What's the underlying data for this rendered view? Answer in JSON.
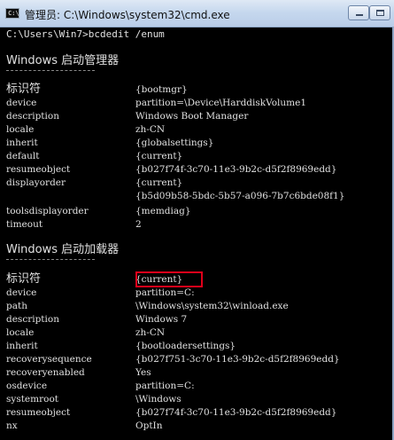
{
  "window": {
    "title": "管理员: C:\\Windows\\system32\\cmd.exe",
    "icon_label": "C:\\"
  },
  "console": {
    "prompt_line": "C:\\Users\\Win7>bcdedit /enum",
    "sections": [
      {
        "heading": "Windows 启动管理器",
        "rows": [
          {
            "key": "标识符",
            "value": "{bootmgr}"
          },
          {
            "key": "device",
            "value": "partition=\\Device\\HarddiskVolume1"
          },
          {
            "key": "description",
            "value": "Windows Boot Manager"
          },
          {
            "key": "locale",
            "value": "zh-CN"
          },
          {
            "key": "inherit",
            "value": "{globalsettings}"
          },
          {
            "key": "default",
            "value": "{current}"
          },
          {
            "key": "resumeobject",
            "value": "{b027f74f-3c70-11e3-9b2c-d5f2f8969edd}"
          },
          {
            "key": "displayorder",
            "value": "{current}"
          },
          {
            "key": "",
            "value": "{b5d09b58-5bdc-5b57-a096-7b7c6bde08f1}"
          },
          {
            "key": "toolsdisplayorder",
            "value": "{memdiag}"
          },
          {
            "key": "timeout",
            "value": "2"
          }
        ]
      },
      {
        "heading": "Windows 启动加载器",
        "rows": [
          {
            "key": "标识符",
            "value": "{current}"
          },
          {
            "key": "device",
            "value": "partition=C:"
          },
          {
            "key": "path",
            "value": "\\Windows\\system32\\winload.exe"
          },
          {
            "key": "description",
            "value": "Windows 7"
          },
          {
            "key": "locale",
            "value": "zh-CN"
          },
          {
            "key": "inherit",
            "value": "{bootloadersettings}"
          },
          {
            "key": "recoverysequence",
            "value": "{b027f751-3c70-11e3-9b2c-d5f2f8969edd}"
          },
          {
            "key": "recoveryenabled",
            "value": "Yes"
          },
          {
            "key": "osdevice",
            "value": "partition=C:"
          },
          {
            "key": "systemroot",
            "value": "\\Windows"
          },
          {
            "key": "resumeobject",
            "value": "{b027f74f-3c70-11e3-9b2c-d5f2f8969edd}"
          },
          {
            "key": "nx",
            "value": "OptIn"
          }
        ]
      }
    ]
  },
  "colors": {
    "console_bg": "#000000",
    "console_text": "#e0e0e0",
    "highlight_border": "#e0001a"
  }
}
